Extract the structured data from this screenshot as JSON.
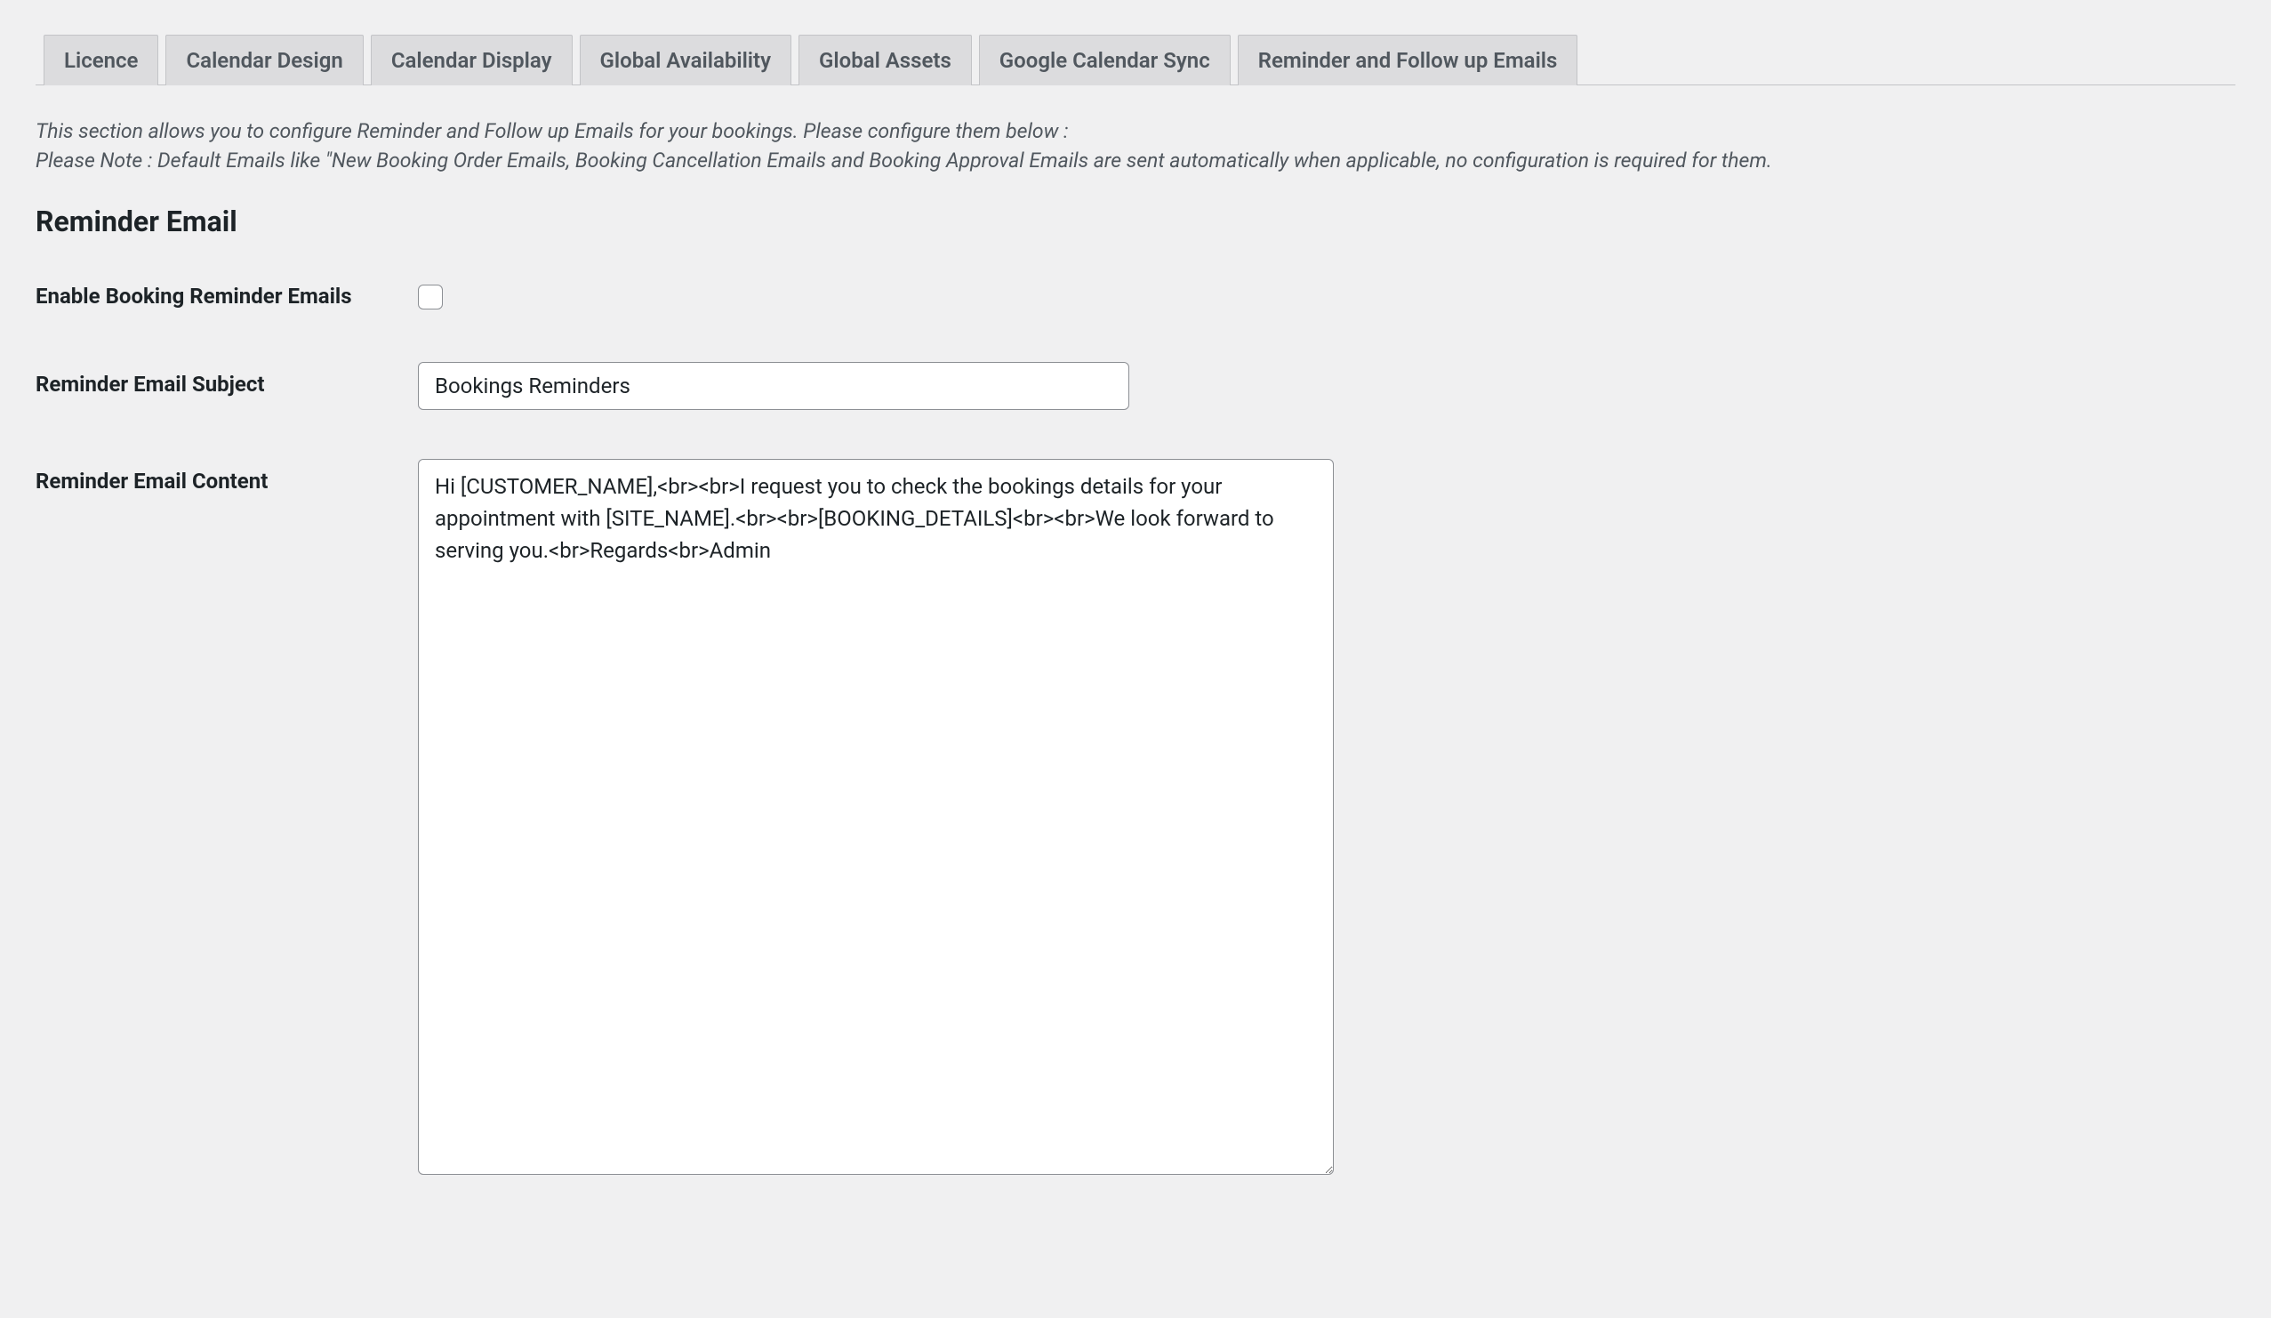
{
  "tabs": [
    {
      "label": "Licence"
    },
    {
      "label": "Calendar Design"
    },
    {
      "label": "Calendar Display"
    },
    {
      "label": "Global Availability"
    },
    {
      "label": "Global Assets"
    },
    {
      "label": "Google Calendar Sync"
    },
    {
      "label": "Reminder and Follow up Emails"
    }
  ],
  "description_line1": "This section allows you to configure Reminder and Follow up Emails for your bookings. Please configure them below :",
  "description_line2": "Please Note : Default Emails like \"New Booking Order Emails, Booking Cancellation Emails and Booking Approval Emails are sent automatically when applicable, no configuration is required for them.",
  "section_title": "Reminder Email",
  "fields": {
    "enable_reminder": {
      "label": "Enable Booking Reminder Emails",
      "checked": false
    },
    "subject": {
      "label": "Reminder Email Subject",
      "value": "Bookings Reminders"
    },
    "content": {
      "label": "Reminder Email Content",
      "value": "Hi [CUSTOMER_NAME],<br><br>I request you to check the bookings details for your appointment with [SITE_NAME].<br><br>[BOOKING_DETAILS]<br><br>We look forward to serving you.<br>Regards<br>Admin"
    }
  }
}
